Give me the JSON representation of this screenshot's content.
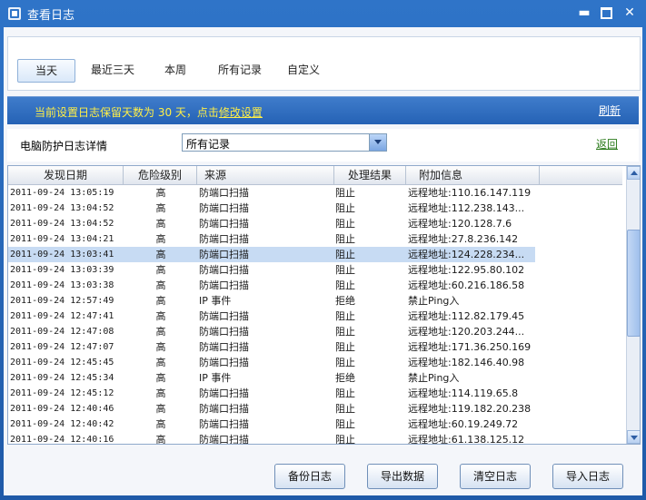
{
  "window": {
    "title": "查看日志"
  },
  "tabs": [
    {
      "label": "当天",
      "active": true
    },
    {
      "label": "最近三天",
      "active": false
    },
    {
      "label": "本周",
      "active": false
    },
    {
      "label": "所有记录",
      "active": false
    },
    {
      "label": "自定义",
      "active": false
    }
  ],
  "banner": {
    "message_prefix": "当前设置日志保留天数为 30 天，点击",
    "message_link": "修改设置",
    "refresh": "刷新"
  },
  "filter": {
    "label": "电脑防护日志详情",
    "selected": "所有记录",
    "back": "返回"
  },
  "table": {
    "columns": [
      "发现日期",
      "危险级别",
      "来源",
      "处理结果",
      "附加信息"
    ],
    "rows": [
      [
        "2011-09-24 13:05:19",
        "高",
        "防端口扫描",
        "阻止",
        "远程地址:110.16.147.119"
      ],
      [
        "2011-09-24 13:04:52",
        "高",
        "防端口扫描",
        "阻止",
        "远程地址:112.238.143..."
      ],
      [
        "2011-09-24 13:04:52",
        "高",
        "防端口扫描",
        "阻止",
        "远程地址:120.128.7.6"
      ],
      [
        "2011-09-24 13:04:21",
        "高",
        "防端口扫描",
        "阻止",
        "远程地址:27.8.236.142"
      ],
      [
        "2011-09-24 13:03:41",
        "高",
        "防端口扫描",
        "阻止",
        "远程地址:124.228.234..."
      ],
      [
        "2011-09-24 13:03:39",
        "高",
        "防端口扫描",
        "阻止",
        "远程地址:122.95.80.102"
      ],
      [
        "2011-09-24 13:03:38",
        "高",
        "防端口扫描",
        "阻止",
        "远程地址:60.216.186.58"
      ],
      [
        "2011-09-24 12:57:49",
        "高",
        "IP 事件",
        "拒绝",
        "禁止Ping入"
      ],
      [
        "2011-09-24 12:47:41",
        "高",
        "防端口扫描",
        "阻止",
        "远程地址:112.82.179.45"
      ],
      [
        "2011-09-24 12:47:08",
        "高",
        "防端口扫描",
        "阻止",
        "远程地址:120.203.244..."
      ],
      [
        "2011-09-24 12:47:07",
        "高",
        "防端口扫描",
        "阻止",
        "远程地址:171.36.250.169"
      ],
      [
        "2011-09-24 12:45:45",
        "高",
        "防端口扫描",
        "阻止",
        "远程地址:182.146.40.98"
      ],
      [
        "2011-09-24 12:45:34",
        "高",
        "IP 事件",
        "拒绝",
        "禁止Ping入"
      ],
      [
        "2011-09-24 12:45:12",
        "高",
        "防端口扫描",
        "阻止",
        "远程地址:114.119.65.8"
      ],
      [
        "2011-09-24 12:40:46",
        "高",
        "防端口扫描",
        "阻止",
        "远程地址:119.182.20.238"
      ],
      [
        "2011-09-24 12:40:42",
        "高",
        "防端口扫描",
        "阻止",
        "远程地址:60.19.249.72"
      ],
      [
        "2011-09-24 12:40:16",
        "高",
        "防端口扫描",
        "阻止",
        "远程地址:61.138.125.12"
      ]
    ],
    "selected_row": 4,
    "scroll_position_fraction": 0.35
  },
  "footer": {
    "buttons": [
      "备份日志",
      "导出数据",
      "清空日志",
      "导入日志"
    ]
  },
  "colors": {
    "title_bar": "#2a65b3",
    "banner_text": "#ffef46",
    "back_link": "#2a7a1a",
    "selected_row": "#c7dbf3"
  },
  "icons": {
    "app": "shield-icon",
    "minimize": "minimize-icon",
    "maximize": "maximize-icon",
    "close": "close-icon"
  }
}
